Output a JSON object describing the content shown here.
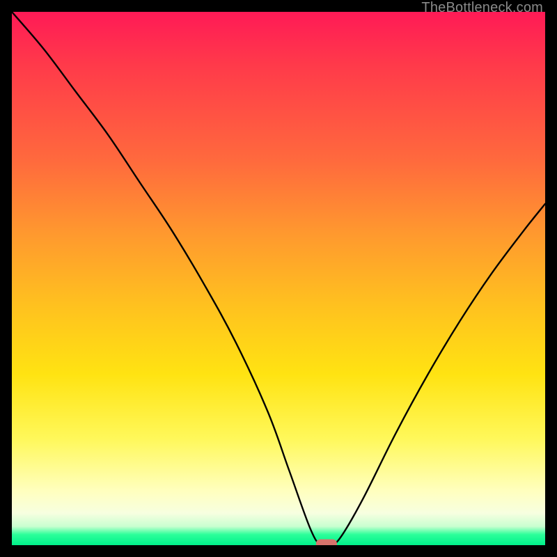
{
  "attribution": "TheBottleneck.com",
  "chart_data": {
    "type": "line",
    "title": "",
    "xlabel": "",
    "ylabel": "",
    "xlim": [
      0,
      100
    ],
    "ylim": [
      0,
      100
    ],
    "grid": false,
    "legend": false,
    "series": [
      {
        "name": "bottleneck-curve",
        "x": [
          0,
          6,
          12,
          18,
          24,
          30,
          36,
          42,
          48,
          52,
          56,
          58,
          60,
          62,
          66,
          72,
          78,
          84,
          90,
          96,
          100
        ],
        "values": [
          100,
          93,
          85,
          77,
          68,
          59,
          49,
          38,
          25,
          14,
          3,
          0,
          0,
          2,
          9,
          21,
          32,
          42,
          51,
          59,
          64
        ]
      }
    ],
    "marker": {
      "x": 59,
      "y": 0,
      "color": "#d6736c",
      "shape": "rounded-rect"
    },
    "background_gradient": {
      "top": "#ff1a56",
      "mid": "#ffe312",
      "bottom": "#00f08a"
    },
    "frame_color": "#000000"
  }
}
